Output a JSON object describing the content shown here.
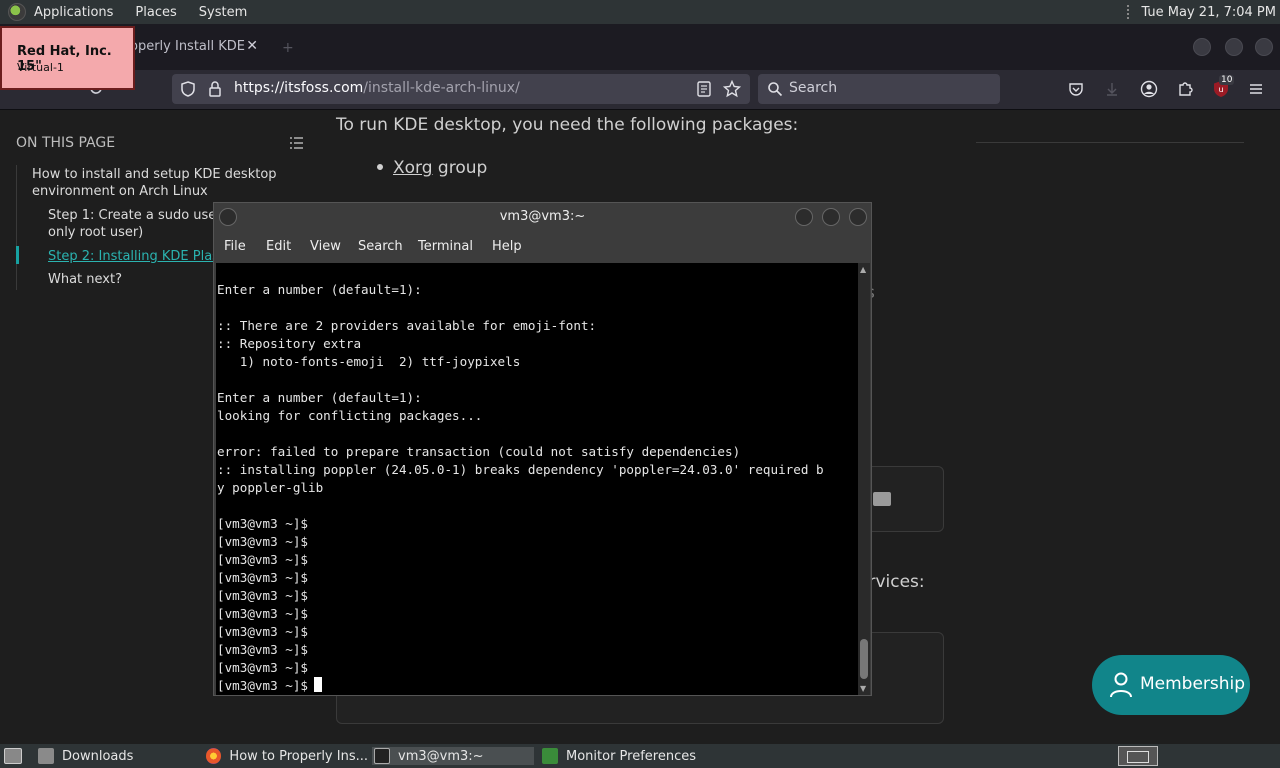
{
  "top_panel": {
    "menus": [
      "Applications",
      "Places",
      "System"
    ],
    "clock": "Tue May 21,  7:04 PM"
  },
  "firefox": {
    "tab_title": "Properly Install KDE",
    "tab_title_visible": "operly Install KDE",
    "url_domain": "https://itsfoss.com",
    "url_path": "/install-kde-arch-linux/",
    "search_placeholder": "Search",
    "extension_badge": "10"
  },
  "overlay_label": {
    "title": "Red Hat, Inc. 15\"",
    "subtitle": "Virtual-1"
  },
  "page": {
    "toc_heading": "ON THIS PAGE",
    "toc_items": [
      "How to install and setup KDE desktop environment on Arch Linux",
      "Step 1: Create a sudo user",
      "only root user)",
      "Step 2: Installing KDE Plas",
      "What next?"
    ],
    "intro_text": "To run KDE desktop, you need the following packages:",
    "bullet_link": "Xorg",
    "bullet_text": " group",
    "partial_s": "s",
    "partial_services": "ervices:",
    "membership_label": "Membership"
  },
  "terminal": {
    "title": "vm3@vm3:~",
    "menu": [
      "File",
      "Edit",
      "View",
      "Search",
      "Terminal",
      "Help"
    ],
    "lines": [
      "Enter a number (default=1):",
      "",
      ":: There are 2 providers available for emoji-font:",
      ":: Repository extra",
      "   1) noto-fonts-emoji  2) ttf-joypixels",
      "",
      "Enter a number (default=1):",
      "looking for conflicting packages...",
      "",
      "error: failed to prepare transaction (could not satisfy dependencies)",
      ":: installing poppler (24.05.0-1) breaks dependency 'poppler=24.03.0' required b",
      "y poppler-glib",
      "",
      "[vm3@vm3 ~]$",
      "[vm3@vm3 ~]$",
      "[vm3@vm3 ~]$",
      "[vm3@vm3 ~]$",
      "[vm3@vm3 ~]$",
      "[vm3@vm3 ~]$",
      "[vm3@vm3 ~]$",
      "[vm3@vm3 ~]$",
      "[vm3@vm3 ~]$"
    ],
    "prompt": "[vm3@vm3 ~]$"
  },
  "taskbar": {
    "items": [
      "Downloads",
      "How to Properly Ins...",
      "vm3@vm3:~",
      "Monitor Preferences"
    ]
  },
  "colors": {
    "accent": "#11858a",
    "link": "#2bb3b0",
    "terminal_bg": "#000000",
    "overlay_bg": "#f4a9ac"
  }
}
